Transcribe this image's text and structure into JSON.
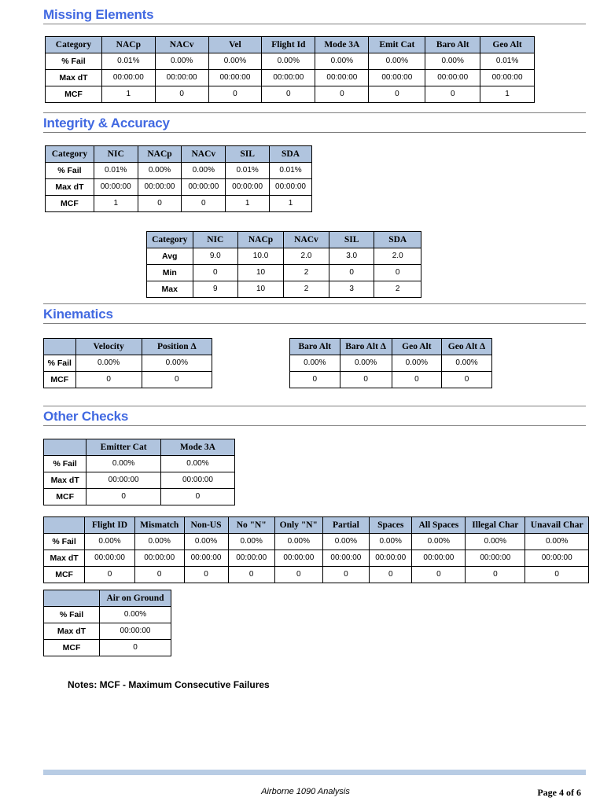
{
  "document": {
    "notes": "Notes:  MCF - Maximum Consecutive Failures",
    "footer_center": "Airborne  1090   Analysis",
    "footer_page": "Page 4 of 6"
  },
  "colors": {
    "heading": "#4169e1",
    "table_header_bg": "#b0c4de",
    "rule": "#7f7f7f",
    "footer_bar": "#b8cce4"
  },
  "sections": [
    {
      "title": "Missing Elements"
    },
    {
      "title": "Integrity & Accuracy"
    },
    {
      "title": "Kinematics"
    },
    {
      "title": "Other Checks"
    }
  ],
  "tables": {
    "missing_elements": {
      "headers": [
        "Category",
        "NACp",
        "NACv",
        "Vel",
        "Flight Id",
        "Mode 3A",
        "Emit Cat",
        "Baro Alt",
        "Geo Alt"
      ],
      "rows": [
        [
          "% Fail",
          "0.01%",
          "0.00%",
          "0.00%",
          "0.00%",
          "0.00%",
          "0.00%",
          "0.00%",
          "0.01%"
        ],
        [
          "Max dT",
          "00:00:00",
          "00:00:00",
          "00:00:00",
          "00:00:00",
          "00:00:00",
          "00:00:00",
          "00:00:00",
          "00:00:00"
        ],
        [
          "MCF",
          "1",
          "0",
          "0",
          "0",
          "0",
          "0",
          "0",
          "1"
        ]
      ]
    },
    "integrity_fail": {
      "headers": [
        "Category",
        "NIC",
        "NACp",
        "NACv",
        "SIL",
        "SDA"
      ],
      "rows": [
        [
          "% Fail",
          "0.01%",
          "0.00%",
          "0.00%",
          "0.01%",
          "0.01%"
        ],
        [
          "Max dT",
          "00:00:00",
          "00:00:00",
          "00:00:00",
          "00:00:00",
          "00:00:00"
        ],
        [
          "MCF",
          "1",
          "0",
          "0",
          "1",
          "1"
        ]
      ]
    },
    "integrity_stats": {
      "headers": [
        "Category",
        "NIC",
        "NACp",
        "NACv",
        "SIL",
        "SDA"
      ],
      "rows": [
        [
          "Avg",
          "9.0",
          "10.0",
          "2.0",
          "3.0",
          "2.0"
        ],
        [
          "Min",
          "0",
          "10",
          "2",
          "0",
          "0"
        ],
        [
          "Max",
          "9",
          "10",
          "2",
          "3",
          "2"
        ]
      ]
    },
    "kinematics_left": {
      "headers": [
        "",
        "Velocity",
        "Position Δ"
      ],
      "rows": [
        [
          "% Fail",
          "0.00%",
          "0.00%"
        ],
        [
          "MCF",
          "0",
          "0"
        ]
      ]
    },
    "kinematics_right": {
      "headers": [
        "Baro Alt",
        "Baro Alt Δ",
        "Geo Alt",
        "Geo Alt Δ"
      ],
      "rows": [
        [
          "0.00%",
          "0.00%",
          "0.00%",
          "0.00%"
        ],
        [
          "0",
          "0",
          "0",
          "0"
        ]
      ]
    },
    "other_emitter": {
      "headers": [
        "",
        "Emitter Cat",
        "Mode 3A"
      ],
      "rows": [
        [
          "% Fail",
          "0.00%",
          "0.00%"
        ],
        [
          "Max dT",
          "00:00:00",
          "00:00:00"
        ],
        [
          "MCF",
          "0",
          "0"
        ]
      ]
    },
    "flight_id": {
      "headers": [
        "",
        "Flight ID",
        "Mismatch",
        "Non-US",
        "No \"N\"",
        "Only \"N\"",
        "Partial",
        "Spaces",
        "All Spaces",
        "Illegal Char",
        "Unavail Char"
      ],
      "rows": [
        [
          "% Fail",
          "0.00%",
          "0.00%",
          "0.00%",
          "0.00%",
          "0.00%",
          "0.00%",
          "0.00%",
          "0.00%",
          "0.00%",
          "0.00%"
        ],
        [
          "Max dT",
          "00:00:00",
          "00:00:00",
          "00:00:00",
          "00:00:00",
          "00:00:00",
          "00:00:00",
          "00:00:00",
          "00:00:00",
          "00:00:00",
          "00:00:00"
        ],
        [
          "MCF",
          "0",
          "0",
          "0",
          "0",
          "0",
          "0",
          "0",
          "0",
          "0",
          "0"
        ]
      ]
    },
    "air_on_ground": {
      "headers": [
        "",
        "Air on Ground"
      ],
      "rows": [
        [
          "% Fail",
          "0.00%"
        ],
        [
          "Max dT",
          "00:00:00"
        ],
        [
          "MCF",
          "0"
        ]
      ]
    }
  }
}
